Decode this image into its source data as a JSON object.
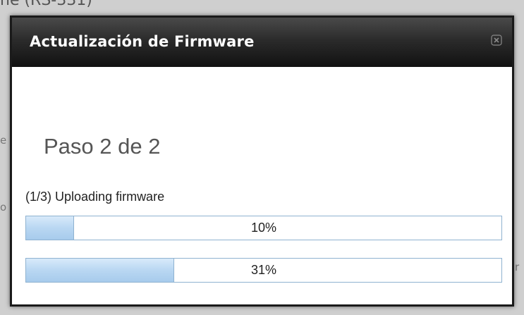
{
  "dialog": {
    "title": "Actualización de Firmware",
    "close_icon": "close-icon",
    "step_title": "Paso 2 de 2",
    "status_text": "(1/3) Uploading firmware",
    "progress_bars": [
      {
        "label": "10%",
        "value": 0.1
      },
      {
        "label": "31%",
        "value": 0.31
      }
    ]
  },
  "colors": {
    "titlebar_dark": "#111111",
    "progress_fill": "#b9d7f2",
    "progress_border": "#8fb2d0"
  }
}
